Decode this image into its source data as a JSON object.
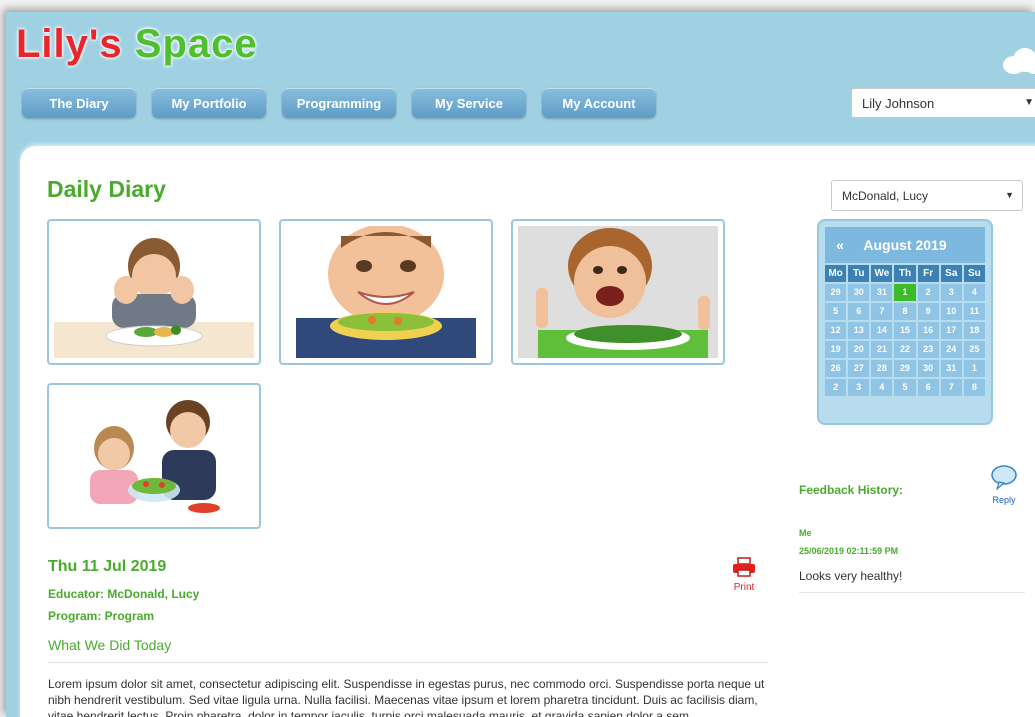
{
  "header": {
    "logo_part1": "Lily's",
    "logo_part2": "Space",
    "nav": [
      {
        "label": "The Diary"
      },
      {
        "label": "My Portfolio"
      },
      {
        "label": "Programming"
      },
      {
        "label": "My Service"
      },
      {
        "label": "My Account"
      }
    ],
    "user_select_value": "Lily Johnson"
  },
  "main": {
    "title": "Daily Diary",
    "photos": [
      {
        "icon": "child-refusing-vegetables-photo"
      },
      {
        "icon": "smiling-boy-bowl-photo"
      },
      {
        "icon": "boy-eating-peas-photo"
      },
      {
        "icon": "children-eating-salad-photo"
      }
    ],
    "entry": {
      "date": "Thu 11 Jul 2019",
      "educator": "Educator: McDonald, Lucy",
      "program": "Program: Program",
      "section_title": "What We Did Today",
      "text": "Lorem ipsum dolor sit amet, consectetur adipiscing elit. Suspendisse in egestas purus, nec commodo orci. Suspendisse porta neque ut nibh hendrerit vestibulum. Sed vitae ligula urna. Nulla facilisi. Maecenas vitae ipsum et lorem pharetra tincidunt. Duis ac facilisis diam, vitae hendrerit lectus. Proin pharetra, dolor in tempor iaculis, turpis orci malesuada mauris, et gravida sapien dolor a sem.",
      "print_label": "Print"
    }
  },
  "sidebar": {
    "child_select_value": "McDonald, Lucy",
    "calendar": {
      "prev": "«",
      "month": "August 2019",
      "days_of_week": [
        "Mo",
        "Tu",
        "We",
        "Th",
        "Fr",
        "Sa",
        "Su"
      ],
      "days": [
        "29",
        "30",
        "31",
        "1",
        "2",
        "3",
        "4",
        "5",
        "6",
        "7",
        "8",
        "9",
        "10",
        "11",
        "12",
        "13",
        "14",
        "15",
        "16",
        "17",
        "18",
        "19",
        "20",
        "21",
        "22",
        "23",
        "24",
        "25",
        "26",
        "27",
        "28",
        "29",
        "30",
        "31",
        "1",
        "2",
        "3",
        "4",
        "5",
        "6",
        "7",
        "8"
      ],
      "selected_day": "1"
    },
    "feedback": {
      "title": "Feedback History:",
      "reply_label": "Reply",
      "author": "Me",
      "timestamp": "25/06/2019 02:11:59 PM",
      "message": "Looks very healthy!"
    }
  },
  "colors": {
    "accent_green": "#4aaa2c",
    "header_blue": "#9fd1e3",
    "nav_blue": "#5f9cc7",
    "logo_red": "#e8262b",
    "logo_green": "#4ec02f",
    "selected_day": "#3cbb2a",
    "print_red": "#e12020"
  }
}
